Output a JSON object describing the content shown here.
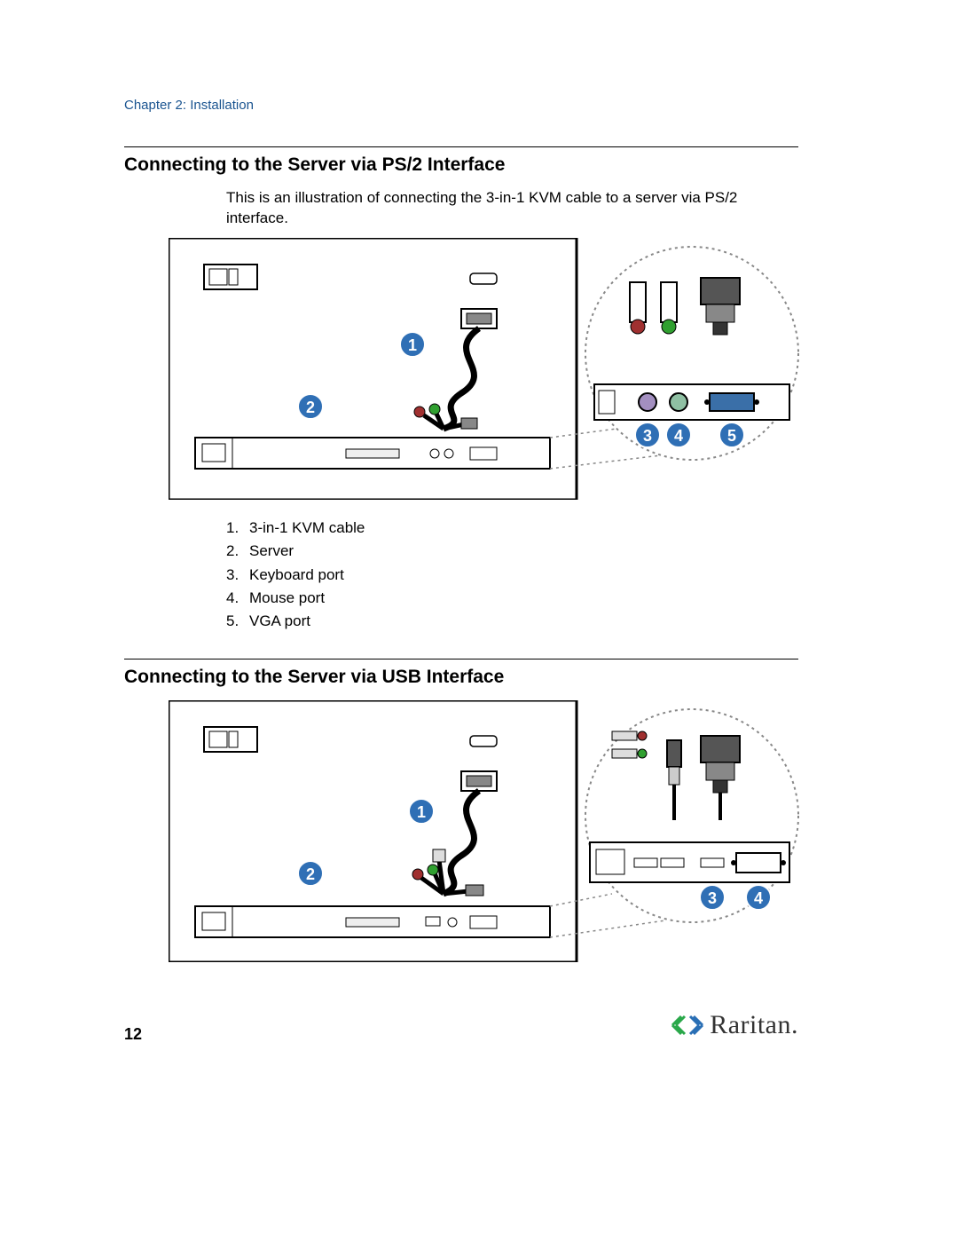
{
  "chapter": "Chapter 2: Installation",
  "section1": {
    "heading": "Connecting to the Server via PS/2 Interface",
    "intro": "This is an illustration of connecting the 3-in-1 KVM cable to a server via PS/2 interface.",
    "callouts": {
      "1": "1",
      "2": "2",
      "3": "3",
      "4": "4",
      "5": "5"
    },
    "list": [
      {
        "n": "1.",
        "t": "3-in-1 KVM cable"
      },
      {
        "n": "2.",
        "t": "Server"
      },
      {
        "n": "3.",
        "t": "Keyboard port"
      },
      {
        "n": "4.",
        "t": "Mouse port"
      },
      {
        "n": "5.",
        "t": "VGA port"
      }
    ]
  },
  "section2": {
    "heading": "Connecting to the Server via USB Interface",
    "callouts": {
      "1": "1",
      "2": "2",
      "3": "3",
      "4": "4"
    }
  },
  "page_number": "12",
  "brand": "Raritan."
}
